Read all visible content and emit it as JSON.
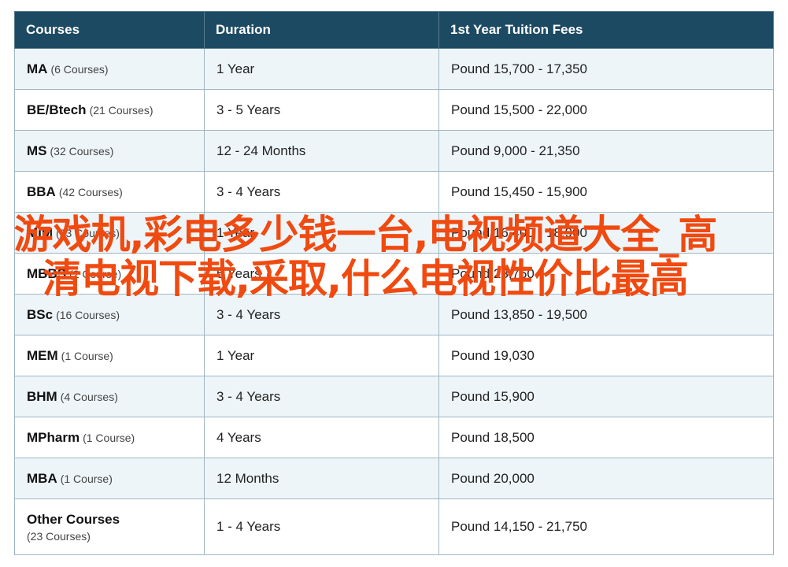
{
  "table": {
    "headers": [
      "Courses",
      "Duration",
      "1st Year Tuition Fees"
    ],
    "rows": [
      {
        "course": "MA",
        "count": "(6 Courses)",
        "duration": "1 Year",
        "fees": "Pound 15,700 - 17,350"
      },
      {
        "course": "BE/Btech",
        "count": "(21 Courses)",
        "duration": "3 - 5 Years",
        "fees": "Pound 15,500 - 22,000"
      },
      {
        "course": "MS",
        "count": "(32 Courses)",
        "duration": "12 - 24 Months",
        "fees": "Pound 9,000 - 21,350"
      },
      {
        "course": "BBA",
        "count": "(42 Courses)",
        "duration": "3 - 4 Years",
        "fees": "Pound 15,450 - 15,900"
      },
      {
        "course": "MIM",
        "count": "(23 Courses)",
        "duration": "1 Year",
        "fees": "Pound 16,400 - 18,900"
      },
      {
        "course": "MBBS",
        "count": "(2 Course)",
        "duration": "5 Years",
        "fees": "Pound 28,750"
      },
      {
        "course": "BSc",
        "count": "(16 Courses)",
        "duration": "3 - 4 Years",
        "fees": "Pound 13,850 - 19,500"
      },
      {
        "course": "MEM",
        "count": "(1 Course)",
        "duration": "1 Year",
        "fees": "Pound 19,030"
      },
      {
        "course": "BHM",
        "count": "(4 Courses)",
        "duration": "3 - 4 Years",
        "fees": "Pound 15,900"
      },
      {
        "course": "MPharm",
        "count": "(1 Course)",
        "duration": "4 Years",
        "fees": "Pound 18,500"
      },
      {
        "course": "MBA",
        "count": "(1 Course)",
        "duration": "12 Months",
        "fees": "Pound 20,000"
      },
      {
        "course": "Other Courses",
        "count": "(23 Courses)",
        "duration": "1 - 4 Years",
        "fees": "Pound 14,150 - 21,750"
      }
    ]
  },
  "overlay_text": "游戏机,彩电多少钱一台,电视频道大全_高清电视下载,采取,什么电视性价比最高",
  "colors": {
    "header_bg": "#1d4a63",
    "row_alt": "#eef5f9",
    "overlay": "#f04a10"
  }
}
